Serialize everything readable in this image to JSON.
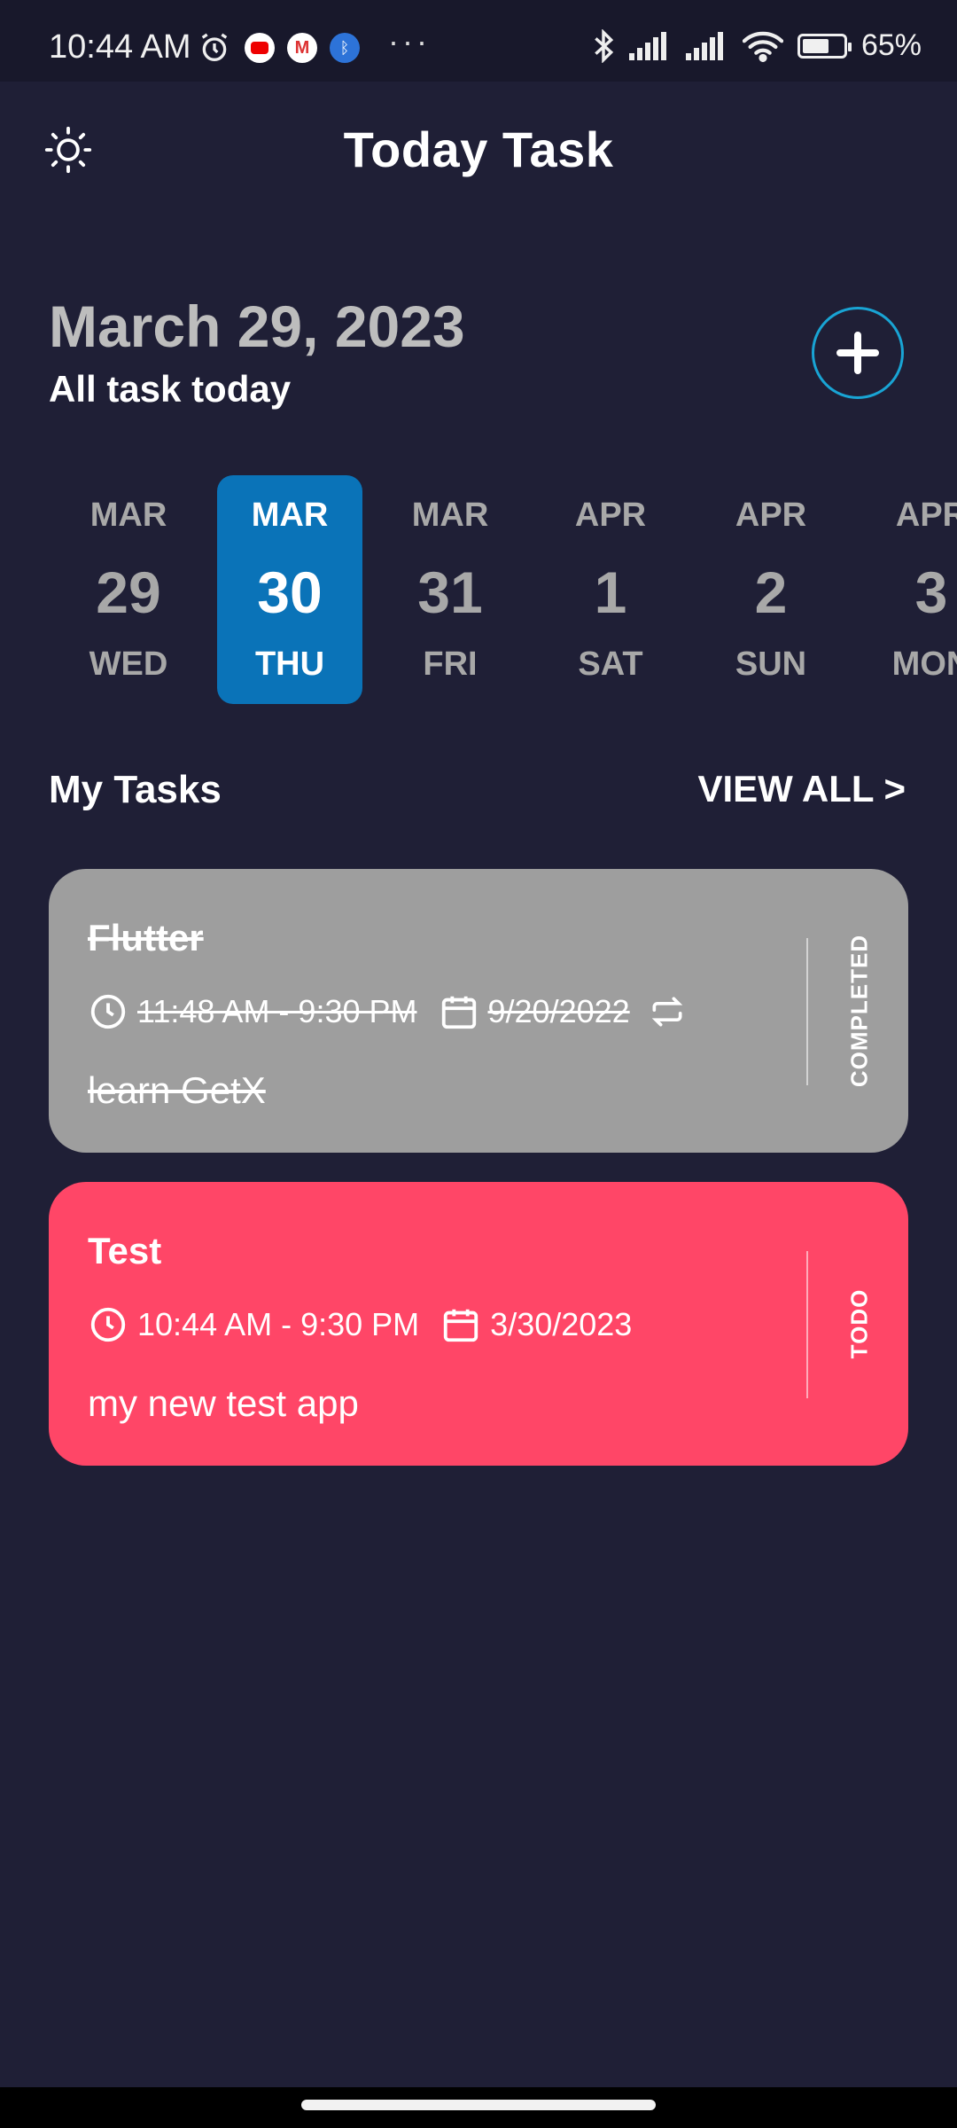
{
  "status_bar": {
    "time": "10:44 AM",
    "battery_text": "65%",
    "battery_level": 0.65,
    "more": "···",
    "icons": [
      "alarm-icon",
      "youtube-icon",
      "gmail-icon",
      "bluetooth-app-icon",
      "bluetooth-icon",
      "signal-icon",
      "signal-2-icon",
      "wifi-icon",
      "battery-icon"
    ]
  },
  "header": {
    "title": "Today Task",
    "theme_icon": "sun-icon"
  },
  "date_header": {
    "date": "March 29, 2023",
    "subtitle": "All task today",
    "add_icon": "plus-icon"
  },
  "date_picker": {
    "selected_index": 1,
    "days": [
      {
        "month": "MAR",
        "day": "29",
        "weekday": "WED"
      },
      {
        "month": "MAR",
        "day": "30",
        "weekday": "THU"
      },
      {
        "month": "MAR",
        "day": "31",
        "weekday": "FRI"
      },
      {
        "month": "APR",
        "day": "1",
        "weekday": "SAT"
      },
      {
        "month": "APR",
        "day": "2",
        "weekday": "SUN"
      },
      {
        "month": "APR",
        "day": "3",
        "weekday": "MON"
      }
    ]
  },
  "tasks_section": {
    "title": "My Tasks",
    "view_all": "VIEW ALL >"
  },
  "tasks": [
    {
      "title": "Flutter",
      "time": "11:48 AM - 9:30 PM",
      "date": "9/20/2022",
      "note": "learn GetX",
      "status": "COMPLETED",
      "color": "#9e9e9e",
      "repeat": true,
      "completed": true
    },
    {
      "title": "Test",
      "time": "10:44 AM - 9:30 PM",
      "date": "3/30/2023",
      "note": "my new test app",
      "status": "TODO",
      "color": "#ff4667",
      "repeat": false,
      "completed": false
    }
  ],
  "colors": {
    "background": "#1f1f36",
    "accent": "#0a73b8",
    "add_border": "#19a4d4"
  }
}
